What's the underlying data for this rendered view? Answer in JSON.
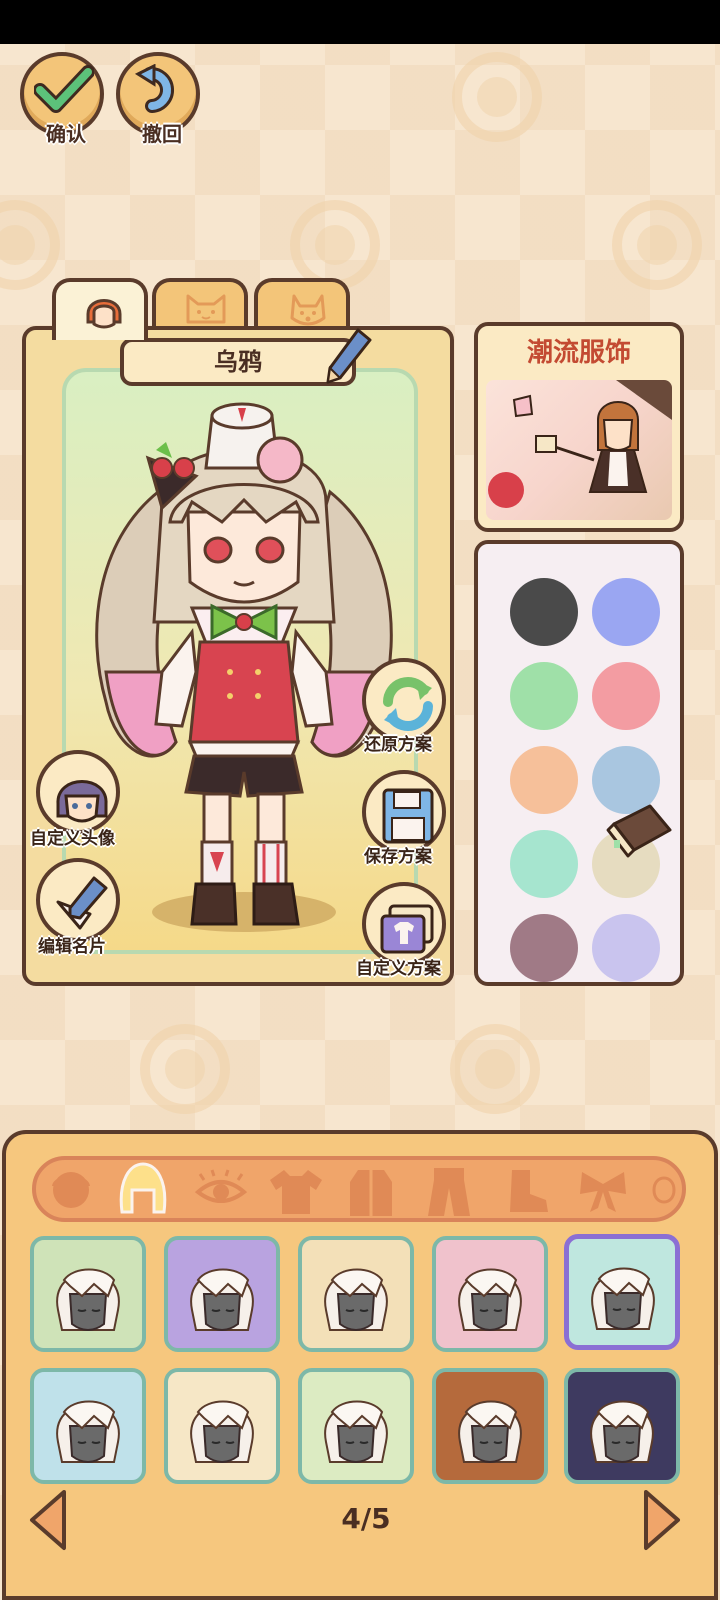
{
  "top_buttons": {
    "confirm_label": "确认",
    "undo_label": "撤回"
  },
  "tabs": [
    {
      "name": "character",
      "icon": "girl-face-icon",
      "active": true
    },
    {
      "name": "pet-1",
      "icon": "cat-face-icon",
      "active": false
    },
    {
      "name": "pet-2",
      "icon": "dog-face-icon",
      "active": false
    }
  ],
  "character": {
    "name": "乌鸦"
  },
  "side_actions": {
    "restore_label": "还原方案",
    "save_label": "保存方案",
    "custom_plan_label": "自定义方案",
    "custom_avatar_label": "自定义头像",
    "edit_card_label": "编辑名片"
  },
  "trend": {
    "title": "潮流服饰"
  },
  "colors": [
    "#4a4a4a",
    "#9aa6f2",
    "#9fe0a8",
    "#f39ca2",
    "#f6c09a",
    "#a9c6e0",
    "#a6e5cf",
    "#e6dcc0",
    "#a07a86",
    "#c9c4ee"
  ],
  "categories": [
    {
      "name": "face",
      "icon": "face-icon"
    },
    {
      "name": "hair",
      "icon": "hair-icon",
      "active": true
    },
    {
      "name": "eyes",
      "icon": "eye-icon"
    },
    {
      "name": "tops",
      "icon": "shirt-icon"
    },
    {
      "name": "coat",
      "icon": "coat-icon"
    },
    {
      "name": "bottoms",
      "icon": "pants-icon"
    },
    {
      "name": "shoes",
      "icon": "boot-icon"
    },
    {
      "name": "accessory",
      "icon": "bow-icon"
    }
  ],
  "items": [
    {
      "bg": "#cfe3b8",
      "selected": false
    },
    {
      "bg": "#b9a3e0",
      "selected": false
    },
    {
      "bg": "#f3e0b8",
      "selected": false
    },
    {
      "bg": "#f0c2cc",
      "selected": false
    },
    {
      "bg": "#bfe7df",
      "selected": true
    },
    {
      "bg": "#bfe1ea",
      "selected": false
    },
    {
      "bg": "#f6e7c6",
      "selected": false
    },
    {
      "bg": "#dcebc2",
      "selected": false
    },
    {
      "bg": "#b56a3c",
      "selected": false
    },
    {
      "bg": "#3e3a60",
      "selected": false
    }
  ],
  "pagination": {
    "label": "4/5"
  }
}
